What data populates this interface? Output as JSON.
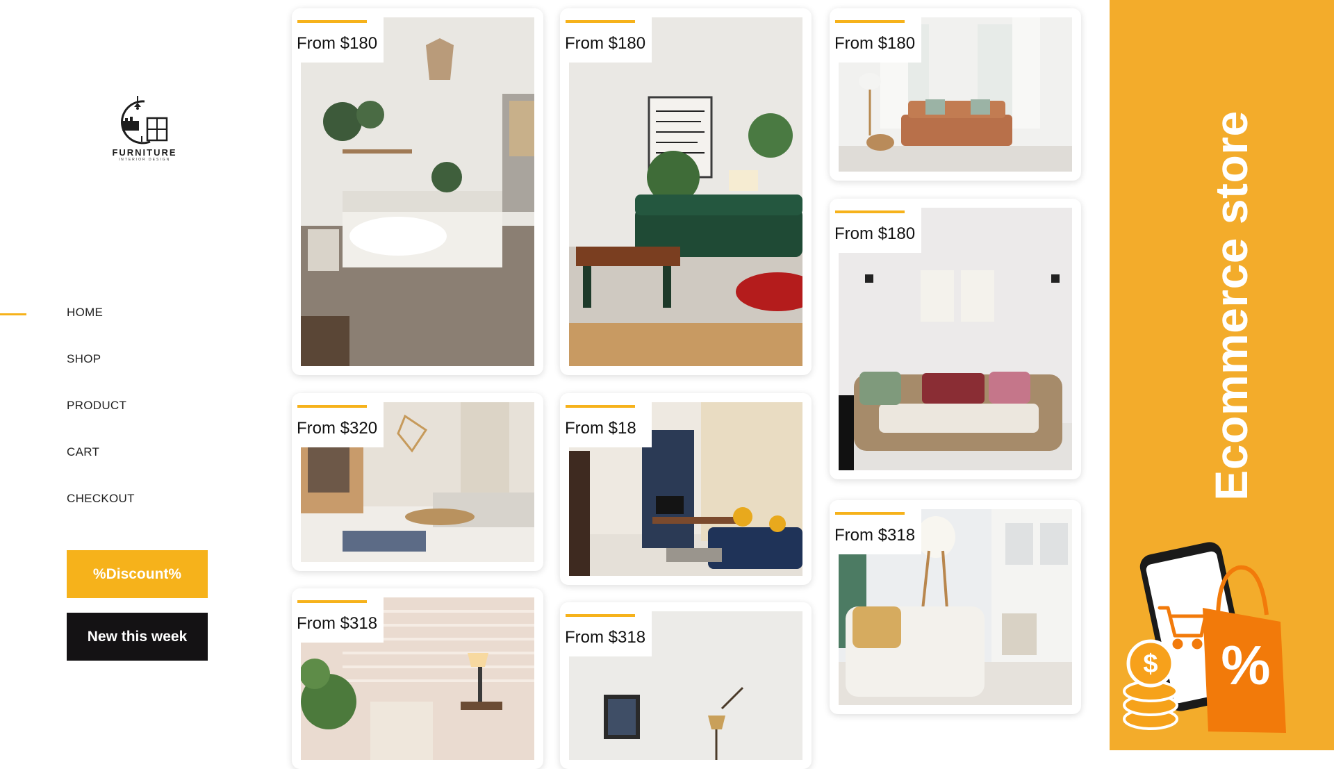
{
  "brand": {
    "name": "FURNITURE",
    "tagline": "INTERIOR DESIGN"
  },
  "nav": {
    "items": [
      "HOME",
      "SHOP",
      "PRODUCT",
      "CART",
      "CHECKOUT"
    ],
    "active": "HOME"
  },
  "buttons": {
    "discount": "%Discount%",
    "new_this_week": "New this week"
  },
  "products": [
    {
      "price": "From $180",
      "scene": "bedroom"
    },
    {
      "price": "From $180",
      "scene": "green-sofa-living-room"
    },
    {
      "price": "From $180",
      "scene": "tan-sofa-bright-room"
    },
    {
      "price": "From $320",
      "scene": "open-living-room"
    },
    {
      "price": "From $18",
      "scene": "navy-wall-living-room"
    },
    {
      "price": "From $180",
      "scene": "wicker-loveseat"
    },
    {
      "price": "From $318",
      "scene": "desk-lamp-corner"
    },
    {
      "price": "From $318",
      "scene": "white-room-lamp"
    },
    {
      "price": "From $318",
      "scene": "white-armchair-kitchen"
    }
  ],
  "banner": {
    "title": "Ecommerce store",
    "badge_percent": "%",
    "coin_symbol": "$"
  },
  "colors": {
    "accent": "#f6b21b",
    "banner_bg": "#f3ac2b",
    "dark": "#141214"
  }
}
